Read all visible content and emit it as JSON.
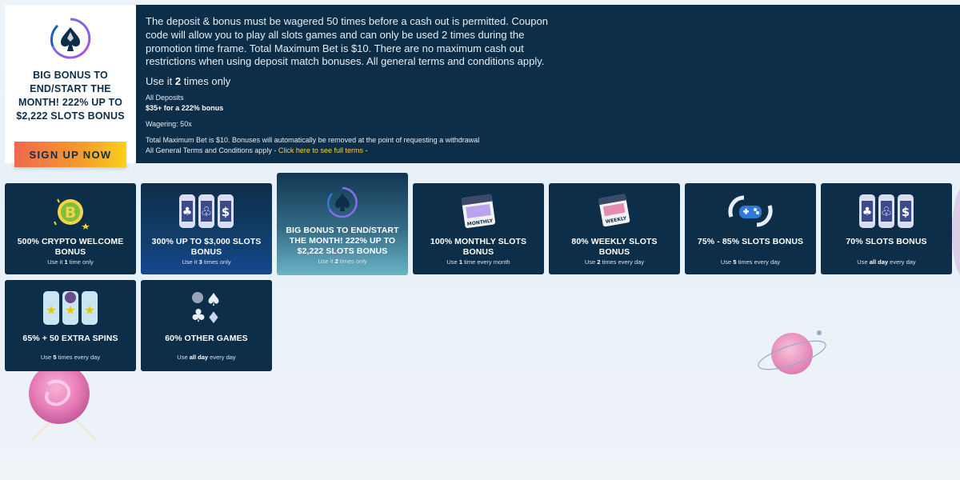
{
  "detail": {
    "title": "BIG BONUS TO END/START THE MONTH! 222% UP TO $2,222 SLOTS BONUS",
    "signup_label": "SIGN UP NOW",
    "description": "The deposit & bonus must be wagered 50 times before a cash out is permitted. Coupon code will allow you to play all slots games and can only be used 2 times during the promotion time frame. Total Maximum Bet is $10. There are no maximum cash out restrictions when using deposit match bonuses. All general terms and conditions apply.",
    "use_prefix": "Use it ",
    "use_count": "2",
    "use_suffix": " times only",
    "deposits_label": "All Deposits",
    "deposits_value": "$35+ for a 222% bonus",
    "wagering": "Wagering: 50x",
    "terms_line1": "Total Maximum Bet is $10. Bonuses will automatically be removed at the point of requesting a withdrawal",
    "terms_line2": "All General Terms and Conditions apply - ",
    "terms_link": "Click here to see full terms",
    "terms_suffix": " -"
  },
  "cards": [
    {
      "label": "500% CRYPTO WELCOME BONUS",
      "use_pre": "Use it ",
      "use_bold": "1",
      "use_post": " time only",
      "icon": "bitcoin-icon"
    },
    {
      "label": "300% UP TO $3,000 SLOTS BONUS",
      "use_pre": "Use it ",
      "use_bold": "3",
      "use_post": " times only",
      "icon": "slot-reels-icon"
    },
    {
      "label": "BIG BONUS TO END/START THE MONTH! 222% UP TO $2,222 SLOTS BONUS",
      "use_pre": "Use it ",
      "use_bold": "2",
      "use_post": " times only",
      "icon": "spade-logo-icon"
    },
    {
      "label": "100% MONTHLY SLOTS BONUS",
      "use_pre": "Use ",
      "use_bold": "1",
      "use_post": " time every month",
      "icon": "monthly-calendar-icon"
    },
    {
      "label": "80% WEEKLY SLOTS BONUS",
      "use_pre": "Use ",
      "use_bold": "2",
      "use_post": " times every day",
      "icon": "weekly-calendar-icon"
    },
    {
      "label": "75% - 85% SLOTS BONUS",
      "use_pre": "Use ",
      "use_bold": "5",
      "use_post": " times every day",
      "icon": "gamepad-icon"
    },
    {
      "label": "70% SLOTS BONUS",
      "use_pre": "Use ",
      "use_bold": "all day",
      "use_post": " every day",
      "icon": "slot-reels-icon"
    },
    {
      "label": "65% + 50 EXTRA SPINS",
      "use_pre": "Use ",
      "use_bold": "5",
      "use_post": " times every day",
      "icon": "star-reels-icon"
    },
    {
      "label": "60% OTHER GAMES",
      "use_pre": "Use ",
      "use_bold": "all day",
      "use_post": " every day",
      "icon": "card-suits-icon"
    }
  ],
  "monthly_word": "MONTHLY",
  "weekly_word": "WEEKLY",
  "colors": {
    "navy": "#0d2e48",
    "gold": "#f4d24a",
    "cta_start": "#ee6a4c",
    "cta_end": "#f8d21a",
    "accent_purple": "#7b4fd6"
  }
}
